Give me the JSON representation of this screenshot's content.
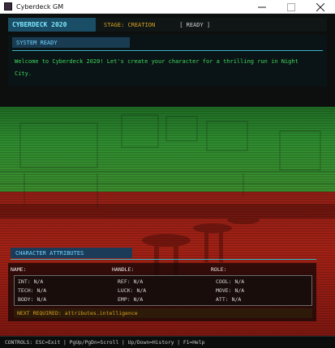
{
  "window": {
    "title": "Cyberdeck GM",
    "icons": [
      "app-icon",
      "minimize-icon",
      "maximize-icon",
      "close-icon"
    ]
  },
  "header": {
    "title": "CYBERDECK 2020",
    "stage": "STAGE: CREATION",
    "status": "[ READY ]"
  },
  "system": {
    "title": "SYSTEM READY",
    "message": "Welcome to Cyberdeck 2020! Let's create your character for a thrilling run in Night City."
  },
  "attributes": {
    "title": "CHARACTER ATTRIBUTES",
    "fields": {
      "name": "NAME:",
      "handle": "HANDLE:",
      "role": "ROLE:"
    },
    "stats": [
      [
        "INT: N/A",
        "REF: N/A",
        "COOL: N/A"
      ],
      [
        "TECH: N/A",
        "LUCK: N/A",
        "MOVE: N/A"
      ],
      [
        "BODY: N/A",
        "EMP: N/A",
        "ATT: N/A"
      ]
    ],
    "next_required": "NEXT REQUIRED: attributes.intelligence"
  },
  "footer": {
    "controls": "CONTROLS: ESC=Exit | PgUp/PgDn=Scroll | Up/Down=History | F1=Help"
  },
  "colors": {
    "accent_cyan": "#6fd4ff",
    "accent_amber": "#d9a520",
    "message_green": "#3ed65c",
    "overlay_green": "#2e8c2f",
    "overlay_red": "#a32115"
  }
}
